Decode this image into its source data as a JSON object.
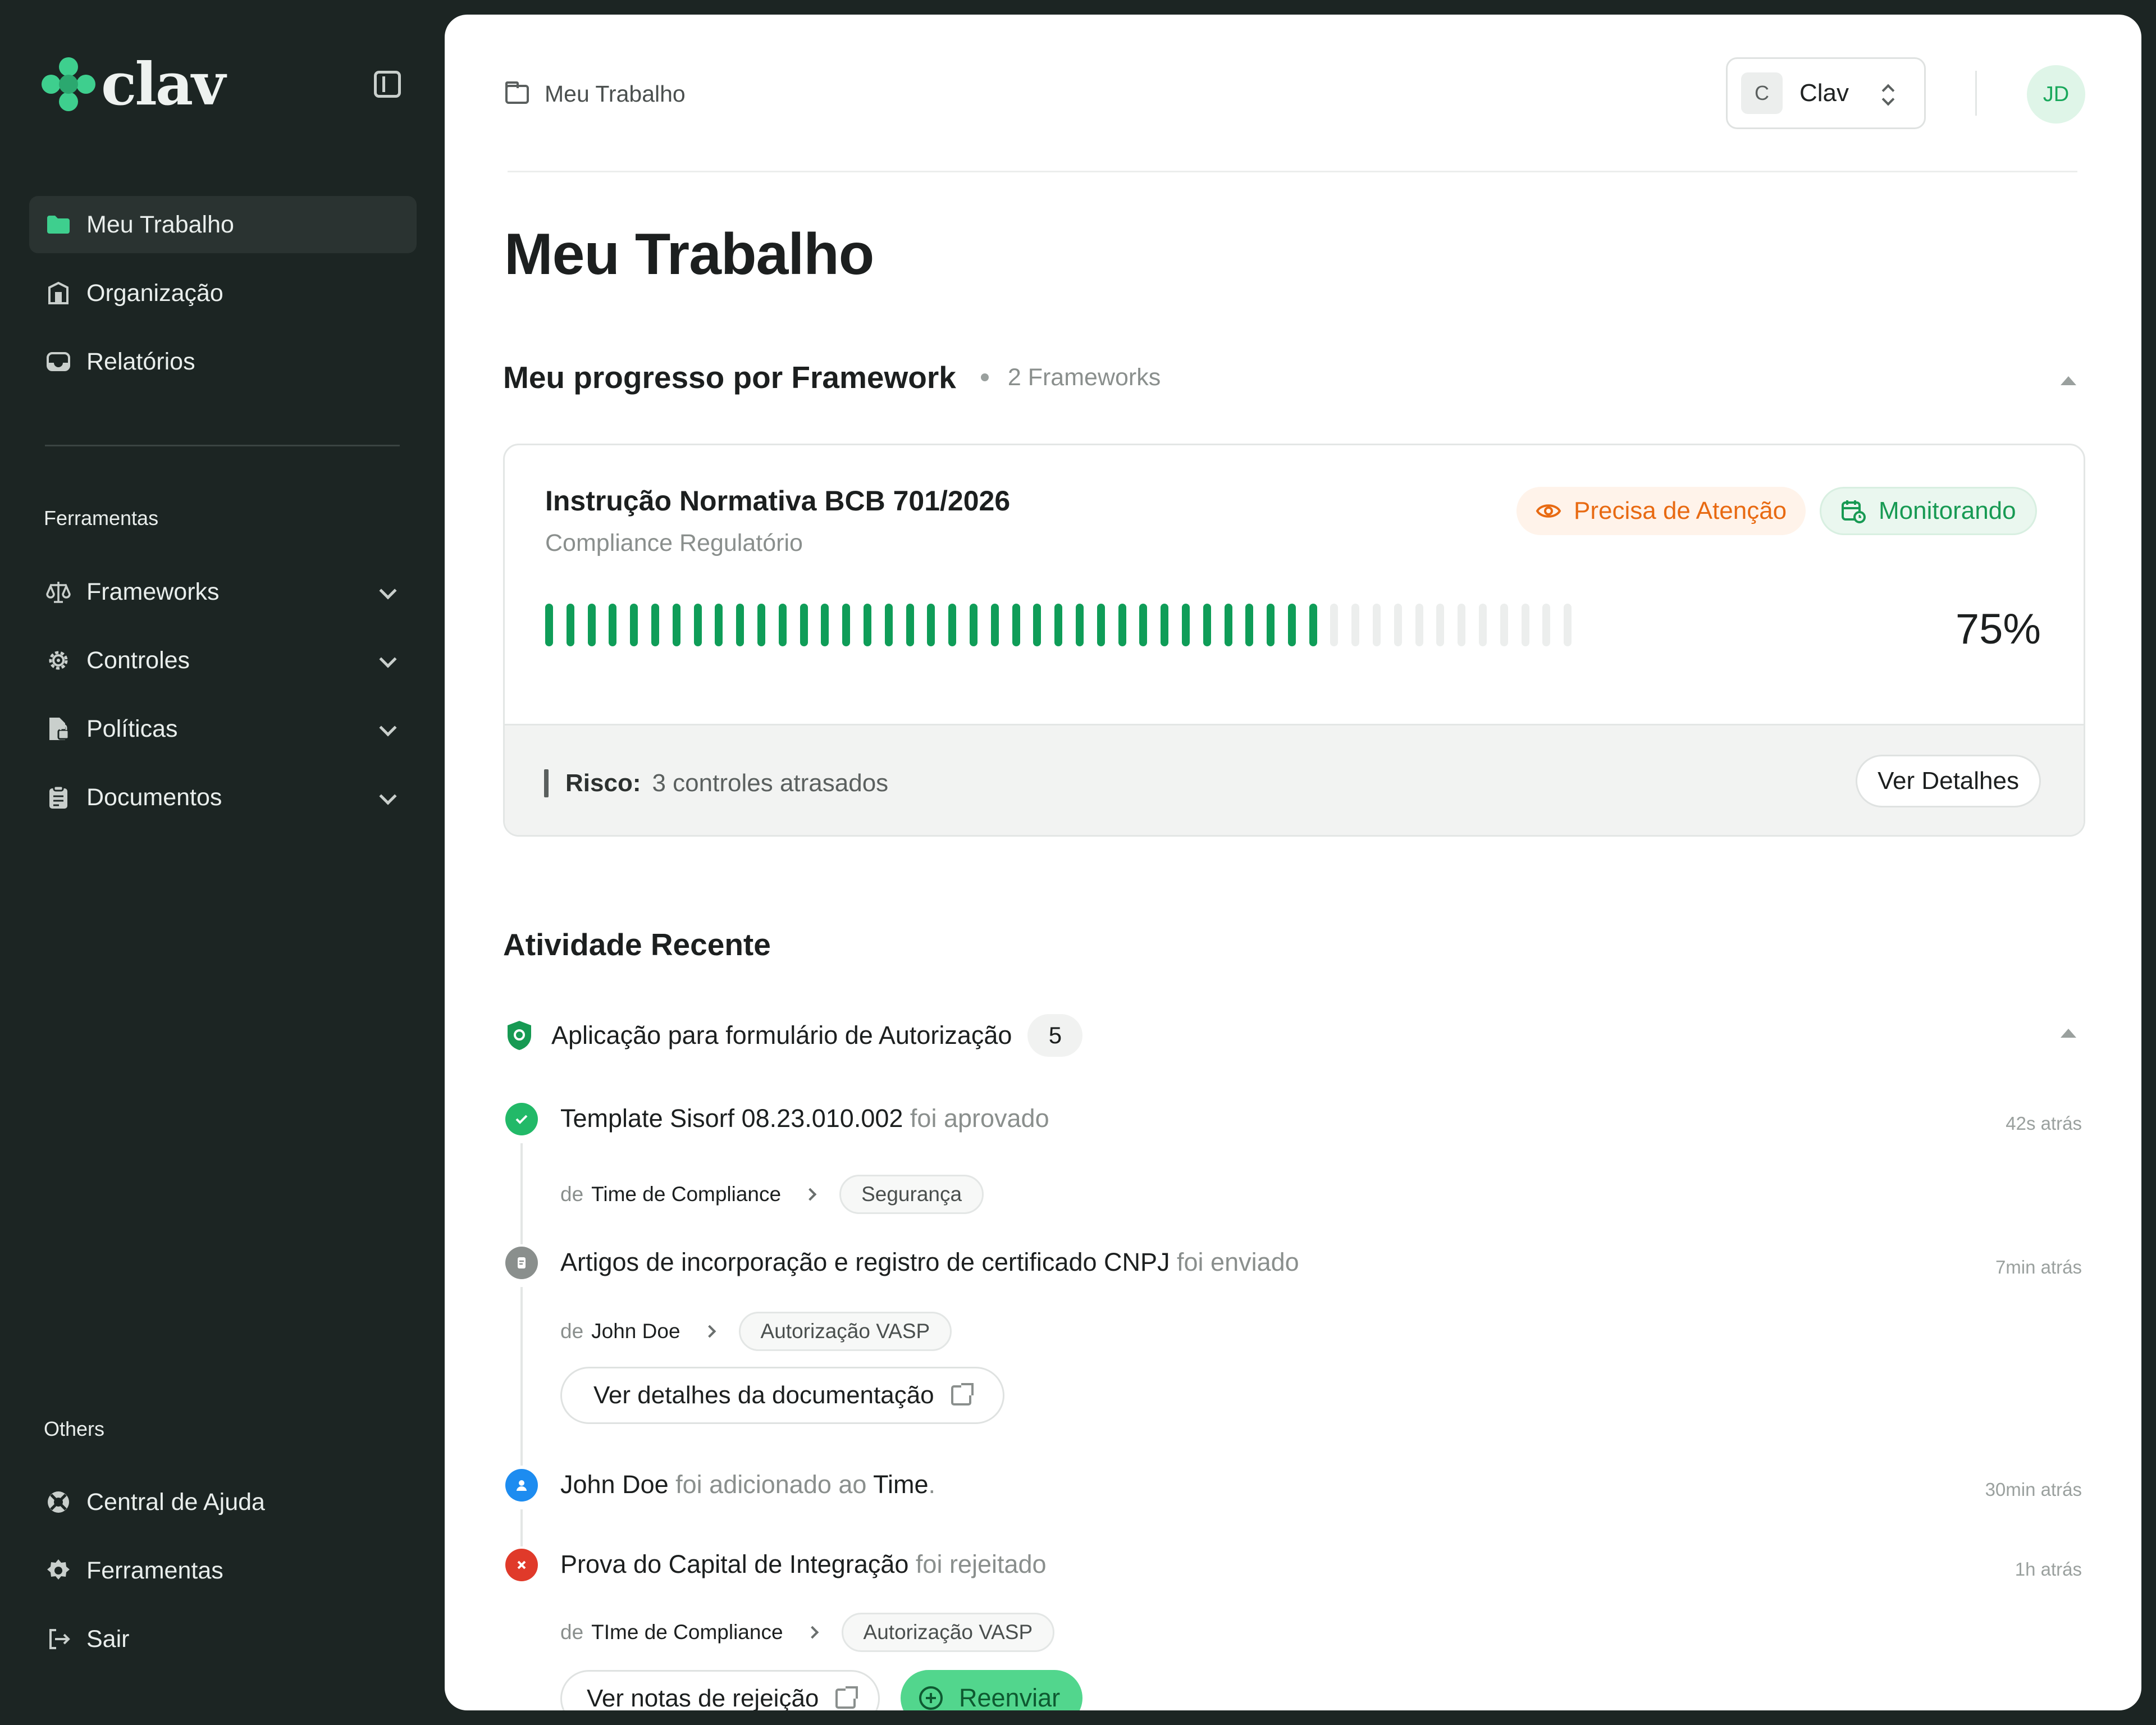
{
  "app": {
    "logo_text": "clav"
  },
  "sidebar": {
    "primary": [
      {
        "label": "Meu Trabalho",
        "icon": "folder-icon"
      },
      {
        "label": "Organização",
        "icon": "building-icon"
      },
      {
        "label": "Relatórios",
        "icon": "inbox-icon"
      }
    ],
    "tools_label": "Ferramentas",
    "tools": [
      {
        "label": "Frameworks",
        "icon": "scale-icon"
      },
      {
        "label": "Controles",
        "icon": "gear-icon"
      },
      {
        "label": "Políticas",
        "icon": "file-lock-icon"
      },
      {
        "label": "Documentos",
        "icon": "clipboard-icon"
      }
    ],
    "others_label": "Others",
    "others": [
      {
        "label": "Central de Ajuda",
        "icon": "lifebuoy-icon"
      },
      {
        "label": "Ferramentas",
        "icon": "cog-icon"
      },
      {
        "label": "Sair",
        "icon": "logout-icon"
      }
    ]
  },
  "header": {
    "breadcrumb": "Meu Trabalho",
    "org_chip": "C",
    "org_name": "Clav",
    "avatar_initials": "JD"
  },
  "page": {
    "title": "Meu Trabalho"
  },
  "progress_section": {
    "title": "Meu progresso por Framework",
    "count": "2 Frameworks",
    "card": {
      "name": "Instrução Normativa BCB 701/2026",
      "category": "Compliance Regulatório",
      "badge_warning": "Precisa de Atenção",
      "badge_status": "Monitorando",
      "progress_percent": 75,
      "progress_label": "75%",
      "risk_label": "Risco:",
      "risk_text": "3 controles atrasados",
      "details_button": "Ver Detalhes"
    }
  },
  "activity": {
    "title": "Atividade Recente",
    "group_title": "Aplicação para formulário de Autorização",
    "group_count": "5",
    "items": [
      {
        "subject": "Template Sisorf  08.23.010.002",
        "action": "foi aprovado",
        "time": "42s atrás",
        "de": "de",
        "author": "Time de Compliance",
        "tag": "Segurança"
      },
      {
        "subject": "Artigos de incorporação e registro de certificado CNPJ",
        "action": "foi enviado",
        "time": "7min atrás",
        "de": "de",
        "author": "John Doe",
        "tag": "Autorização VASP",
        "button": "Ver detalhes da documentação"
      },
      {
        "subject": "John Doe",
        "action": "foi adicionado ao",
        "object": "Time",
        "suffix": ".",
        "time": "30min atrás"
      },
      {
        "subject": "Prova do Capital de Integração",
        "action": "foi rejeitado",
        "time": "1h atrás",
        "de": "de",
        "author": "TIme  de Compliance",
        "tag": "Autorização VASP",
        "button": "Ver notas de rejeição",
        "button2": "Reenviar"
      }
    ]
  },
  "colors": {
    "sidebar_bg": "#1c2523",
    "accent_green": "#3ecf8e",
    "progress_green": "#0f9d58",
    "warning_orange": "#e86a12",
    "error_red": "#e03a2a",
    "info_blue": "#1d8cf0"
  }
}
